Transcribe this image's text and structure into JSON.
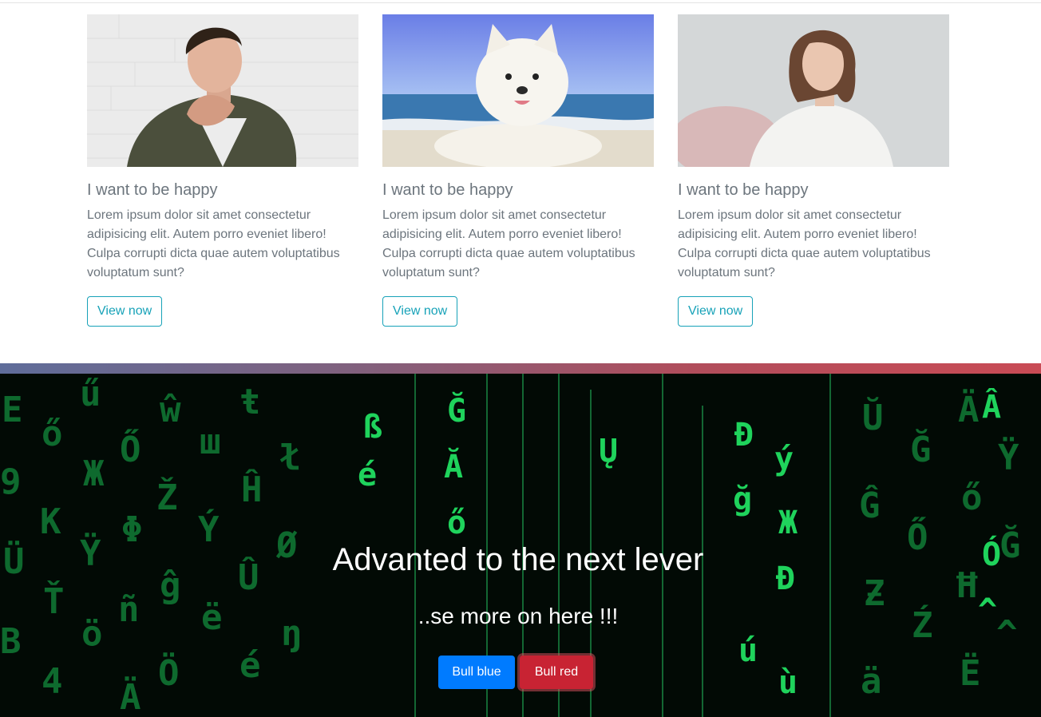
{
  "cards": [
    {
      "title": "I want to be happy",
      "text": "Lorem ipsum dolor sit amet consectetur adipisicing elit. Autem porro eveniet libero! Culpa corrupti dicta quae autem voluptatibus voluptatum sunt?",
      "button": "View now"
    },
    {
      "title": "I want to be happy",
      "text": "Lorem ipsum dolor sit amet consectetur adipisicing elit. Autem porro eveniet libero! Culpa corrupti dicta quae autem voluptatibus voluptatum sunt?",
      "button": "View now"
    },
    {
      "title": "I want to be happy",
      "text": "Lorem ipsum dolor sit amet consectetur adipisicing elit. Autem porro eveniet libero! Culpa corrupti dicta quae autem voluptatibus voluptatum sunt?",
      "button": "View now"
    }
  ],
  "hero": {
    "title": "Advanted to the next lever",
    "subtitle": "..se more on here !!!",
    "blue_button": "Bull blue",
    "red_button": "Bull red"
  },
  "colors": {
    "accent_outline": "#17a2b8",
    "primary": "#007bff",
    "danger": "#c82333",
    "muted_text": "#6c757d",
    "matrix_green": "#1fd35c"
  }
}
